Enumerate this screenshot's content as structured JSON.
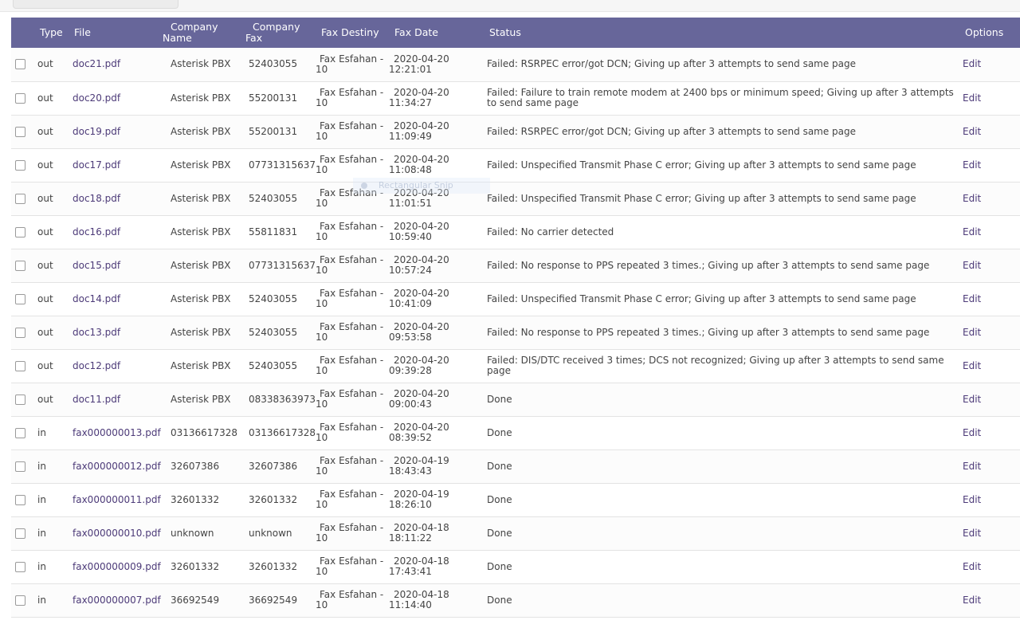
{
  "headers": {
    "type": "Type",
    "file": "File",
    "company_name_1": "Company",
    "company_name_2": "Name",
    "company_fax_1": "Company",
    "company_fax_2": "Fax",
    "fax_destiny": "Fax Destiny",
    "fax_date": "Fax Date",
    "status": "Status",
    "options": "Options"
  },
  "overlay_text": "Rectangular Snip",
  "rows": [
    {
      "type": "out",
      "file": "doc21.pdf",
      "company": "Asterisk PBX",
      "fax": "52403055",
      "dest1": "Fax Esfahan -",
      "dest2": "10",
      "date1": "2020-04-20",
      "date2": "12:21:01",
      "status": "Failed: RSRPEC error/got DCN; Giving up after 3 attempts to send same page",
      "option": "Edit"
    },
    {
      "type": "out",
      "file": "doc20.pdf",
      "company": "Asterisk PBX",
      "fax": "55200131",
      "dest1": "Fax Esfahan -",
      "dest2": "10",
      "date1": "2020-04-20",
      "date2": "11:34:27",
      "status": "Failed: Failure to train remote modem at 2400 bps or minimum speed; Giving up after 3 attempts to send same page",
      "option": "Edit"
    },
    {
      "type": "out",
      "file": "doc19.pdf",
      "company": "Asterisk PBX",
      "fax": "55200131",
      "dest1": "Fax Esfahan -",
      "dest2": "10",
      "date1": "2020-04-20",
      "date2": "11:09:49",
      "status": "Failed: RSRPEC error/got DCN; Giving up after 3 attempts to send same page",
      "option": "Edit"
    },
    {
      "type": "out",
      "file": "doc17.pdf",
      "company": "Asterisk PBX",
      "fax": "07731315637",
      "dest1": "Fax Esfahan -",
      "dest2": "10",
      "date1": "2020-04-20",
      "date2": "11:08:48",
      "status": "Failed: Unspecified Transmit Phase C error; Giving up after 3 attempts to send same page",
      "option": "Edit"
    },
    {
      "type": "out",
      "file": "doc18.pdf",
      "company": "Asterisk PBX",
      "fax": "52403055",
      "dest1": "Fax Esfahan -",
      "dest2": "10",
      "date1": "2020-04-20",
      "date2": "11:01:51",
      "status": "Failed: Unspecified Transmit Phase C error; Giving up after 3 attempts to send same page",
      "option": "Edit"
    },
    {
      "type": "out",
      "file": "doc16.pdf",
      "company": "Asterisk PBX",
      "fax": "55811831",
      "dest1": "Fax Esfahan -",
      "dest2": "10",
      "date1": "2020-04-20",
      "date2": "10:59:40",
      "status": "Failed: No carrier detected",
      "option": "Edit"
    },
    {
      "type": "out",
      "file": "doc15.pdf",
      "company": "Asterisk PBX",
      "fax": "07731315637",
      "dest1": "Fax Esfahan -",
      "dest2": "10",
      "date1": "2020-04-20",
      "date2": "10:57:24",
      "status": "Failed: No response to PPS repeated 3 times.; Giving up after 3 attempts to send same page",
      "option": "Edit"
    },
    {
      "type": "out",
      "file": "doc14.pdf",
      "company": "Asterisk PBX",
      "fax": "52403055",
      "dest1": "Fax Esfahan -",
      "dest2": "10",
      "date1": "2020-04-20",
      "date2": "10:41:09",
      "status": "Failed: Unspecified Transmit Phase C error; Giving up after 3 attempts to send same page",
      "option": "Edit"
    },
    {
      "type": "out",
      "file": "doc13.pdf",
      "company": "Asterisk PBX",
      "fax": "52403055",
      "dest1": "Fax Esfahan -",
      "dest2": "10",
      "date1": "2020-04-20",
      "date2": "09:53:58",
      "status": "Failed: No response to PPS repeated 3 times.; Giving up after 3 attempts to send same page",
      "option": "Edit"
    },
    {
      "type": "out",
      "file": "doc12.pdf",
      "company": "Asterisk PBX",
      "fax": "52403055",
      "dest1": "Fax Esfahan -",
      "dest2": "10",
      "date1": "2020-04-20",
      "date2": "09:39:28",
      "status": "Failed: DIS/DTC received 3 times; DCS not recognized; Giving up after 3 attempts to send same page",
      "option": "Edit"
    },
    {
      "type": "out",
      "file": "doc11.pdf",
      "company": "Asterisk PBX",
      "fax": "08338363973",
      "dest1": "Fax Esfahan -",
      "dest2": "10",
      "date1": "2020-04-20",
      "date2": "09:00:43",
      "status": "Done",
      "option": "Edit"
    },
    {
      "type": "in",
      "file": "fax000000013.pdf",
      "company": "03136617328",
      "fax": "03136617328",
      "dest1": "Fax Esfahan -",
      "dest2": "10",
      "date1": "2020-04-20",
      "date2": "08:39:52",
      "status": "Done",
      "option": "Edit"
    },
    {
      "type": "in",
      "file": "fax000000012.pdf",
      "company": "32607386",
      "fax": "32607386",
      "dest1": "Fax Esfahan -",
      "dest2": "10",
      "date1": "2020-04-19",
      "date2": "18:43:43",
      "status": "Done",
      "option": "Edit"
    },
    {
      "type": "in",
      "file": "fax000000011.pdf",
      "company": "32601332",
      "fax": "32601332",
      "dest1": "Fax Esfahan -",
      "dest2": "10",
      "date1": "2020-04-19",
      "date2": "18:26:10",
      "status": "Done",
      "option": "Edit"
    },
    {
      "type": "in",
      "file": "fax000000010.pdf",
      "company": "unknown",
      "fax": "unknown",
      "dest1": "Fax Esfahan -",
      "dest2": "10",
      "date1": "2020-04-18",
      "date2": "18:11:22",
      "status": "Done",
      "option": "Edit"
    },
    {
      "type": "in",
      "file": "fax000000009.pdf",
      "company": "32601332",
      "fax": "32601332",
      "dest1": "Fax Esfahan -",
      "dest2": "10",
      "date1": "2020-04-18",
      "date2": "17:43:41",
      "status": "Done",
      "option": "Edit"
    },
    {
      "type": "in",
      "file": "fax000000007.pdf",
      "company": "36692549",
      "fax": "36692549",
      "dest1": "Fax Esfahan -",
      "dest2": "10",
      "date1": "2020-04-18",
      "date2": "11:14:40",
      "status": "Done",
      "option": "Edit"
    }
  ]
}
